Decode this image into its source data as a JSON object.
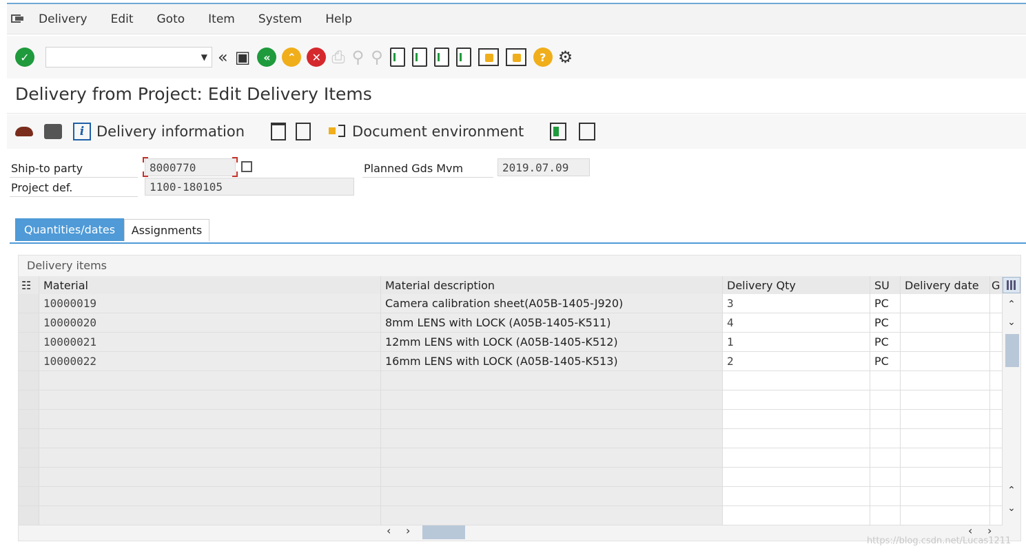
{
  "menubar": {
    "items": [
      "Delivery",
      "Edit",
      "Goto",
      "Item",
      "System",
      "Help"
    ]
  },
  "toolbar": {
    "command_value": ""
  },
  "title": "Delivery from Project: Edit Delivery Items",
  "app_toolbar": {
    "delivery_information": "Delivery information",
    "document_environment": "Document environment"
  },
  "header": {
    "ship_to_label": "Ship-to party",
    "ship_to_value": "8000770",
    "project_label": "Project def.",
    "project_value": "1100-180105",
    "planned_label": "Planned Gds Mvm",
    "planned_value": "2019.07.09"
  },
  "tabs": [
    {
      "label": "Quantities/dates",
      "active": true
    },
    {
      "label": "Assignments",
      "active": false
    }
  ],
  "table": {
    "title": "Delivery items",
    "columns": [
      "Material",
      "Material description",
      "Delivery Qty",
      "SU",
      "Delivery date",
      "G"
    ],
    "rows": [
      {
        "material": "10000019",
        "description": "Camera calibration sheet(A05B-1405-J920)",
        "qty": "3",
        "su": "PC",
        "date": ""
      },
      {
        "material": "10000020",
        "description": "8mm LENS with LOCK (A05B-1405-K511)",
        "qty": "4",
        "su": "PC",
        "date": ""
      },
      {
        "material": "10000021",
        "description": "12mm LENS with LOCK (A05B-1405-K512)",
        "qty": "1",
        "su": "PC",
        "date": ""
      },
      {
        "material": "10000022",
        "description": "16mm LENS with LOCK (A05B-1405-K513)",
        "qty": "2",
        "su": "PC",
        "date": ""
      }
    ],
    "empty_rows": 8
  },
  "watermark": "https://blog.csdn.net/Lucas1211",
  "colors": {
    "accent": "#4f9ad7",
    "green": "#1f9a3c",
    "yellow": "#f0ae1b",
    "red": "#d5282d"
  }
}
